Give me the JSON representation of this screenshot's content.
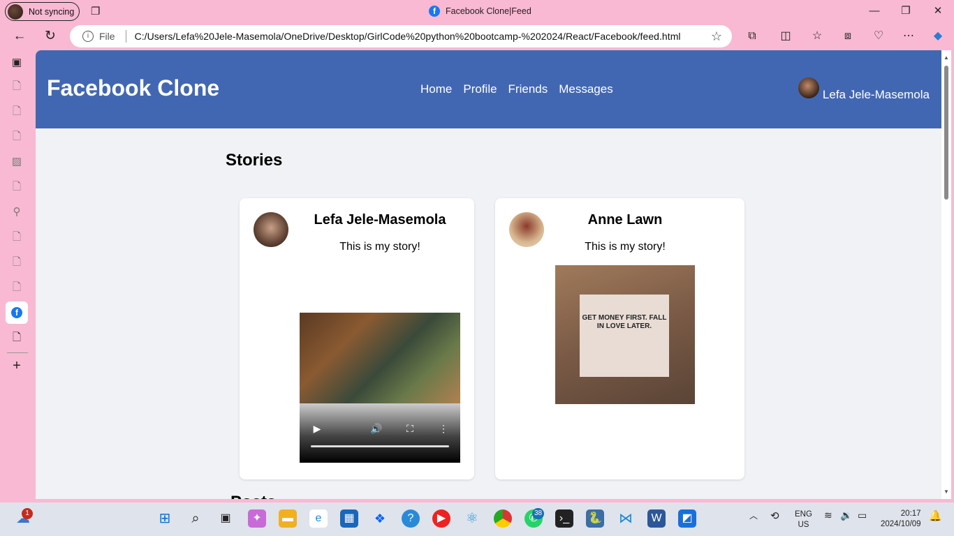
{
  "browser": {
    "profile_label": "Not syncing",
    "window_title": "Facebook Clone|Feed",
    "address": {
      "scheme_label": "File",
      "url": "C:/Users/Lefa%20Jele-Masemola/OneDrive/Desktop/GirlCode%20python%20bootcamp-%202024/React/Facebook/feed.html"
    }
  },
  "page": {
    "brand": "Facebook Clone",
    "nav": [
      "Home",
      "Profile",
      "Friends",
      "Messages"
    ],
    "user_name": "Lefa Jele-Masemola",
    "stories_heading": "Stories",
    "stories": [
      {
        "name": "Lefa Jele-Masemola",
        "text": "This is my story!",
        "media": "video"
      },
      {
        "name": "Anne Lawn",
        "text": "This is my story!",
        "media": "image",
        "image_text": "GET MONEY FIRST. FALL IN LOVE LATER."
      }
    ],
    "posts_heading_peek": "Posts"
  },
  "taskbar": {
    "weather_badge": "1",
    "whatsapp_badge": "38",
    "lang_top": "ENG",
    "lang_bottom": "US",
    "time": "20:17",
    "date": "2024/10/09"
  }
}
